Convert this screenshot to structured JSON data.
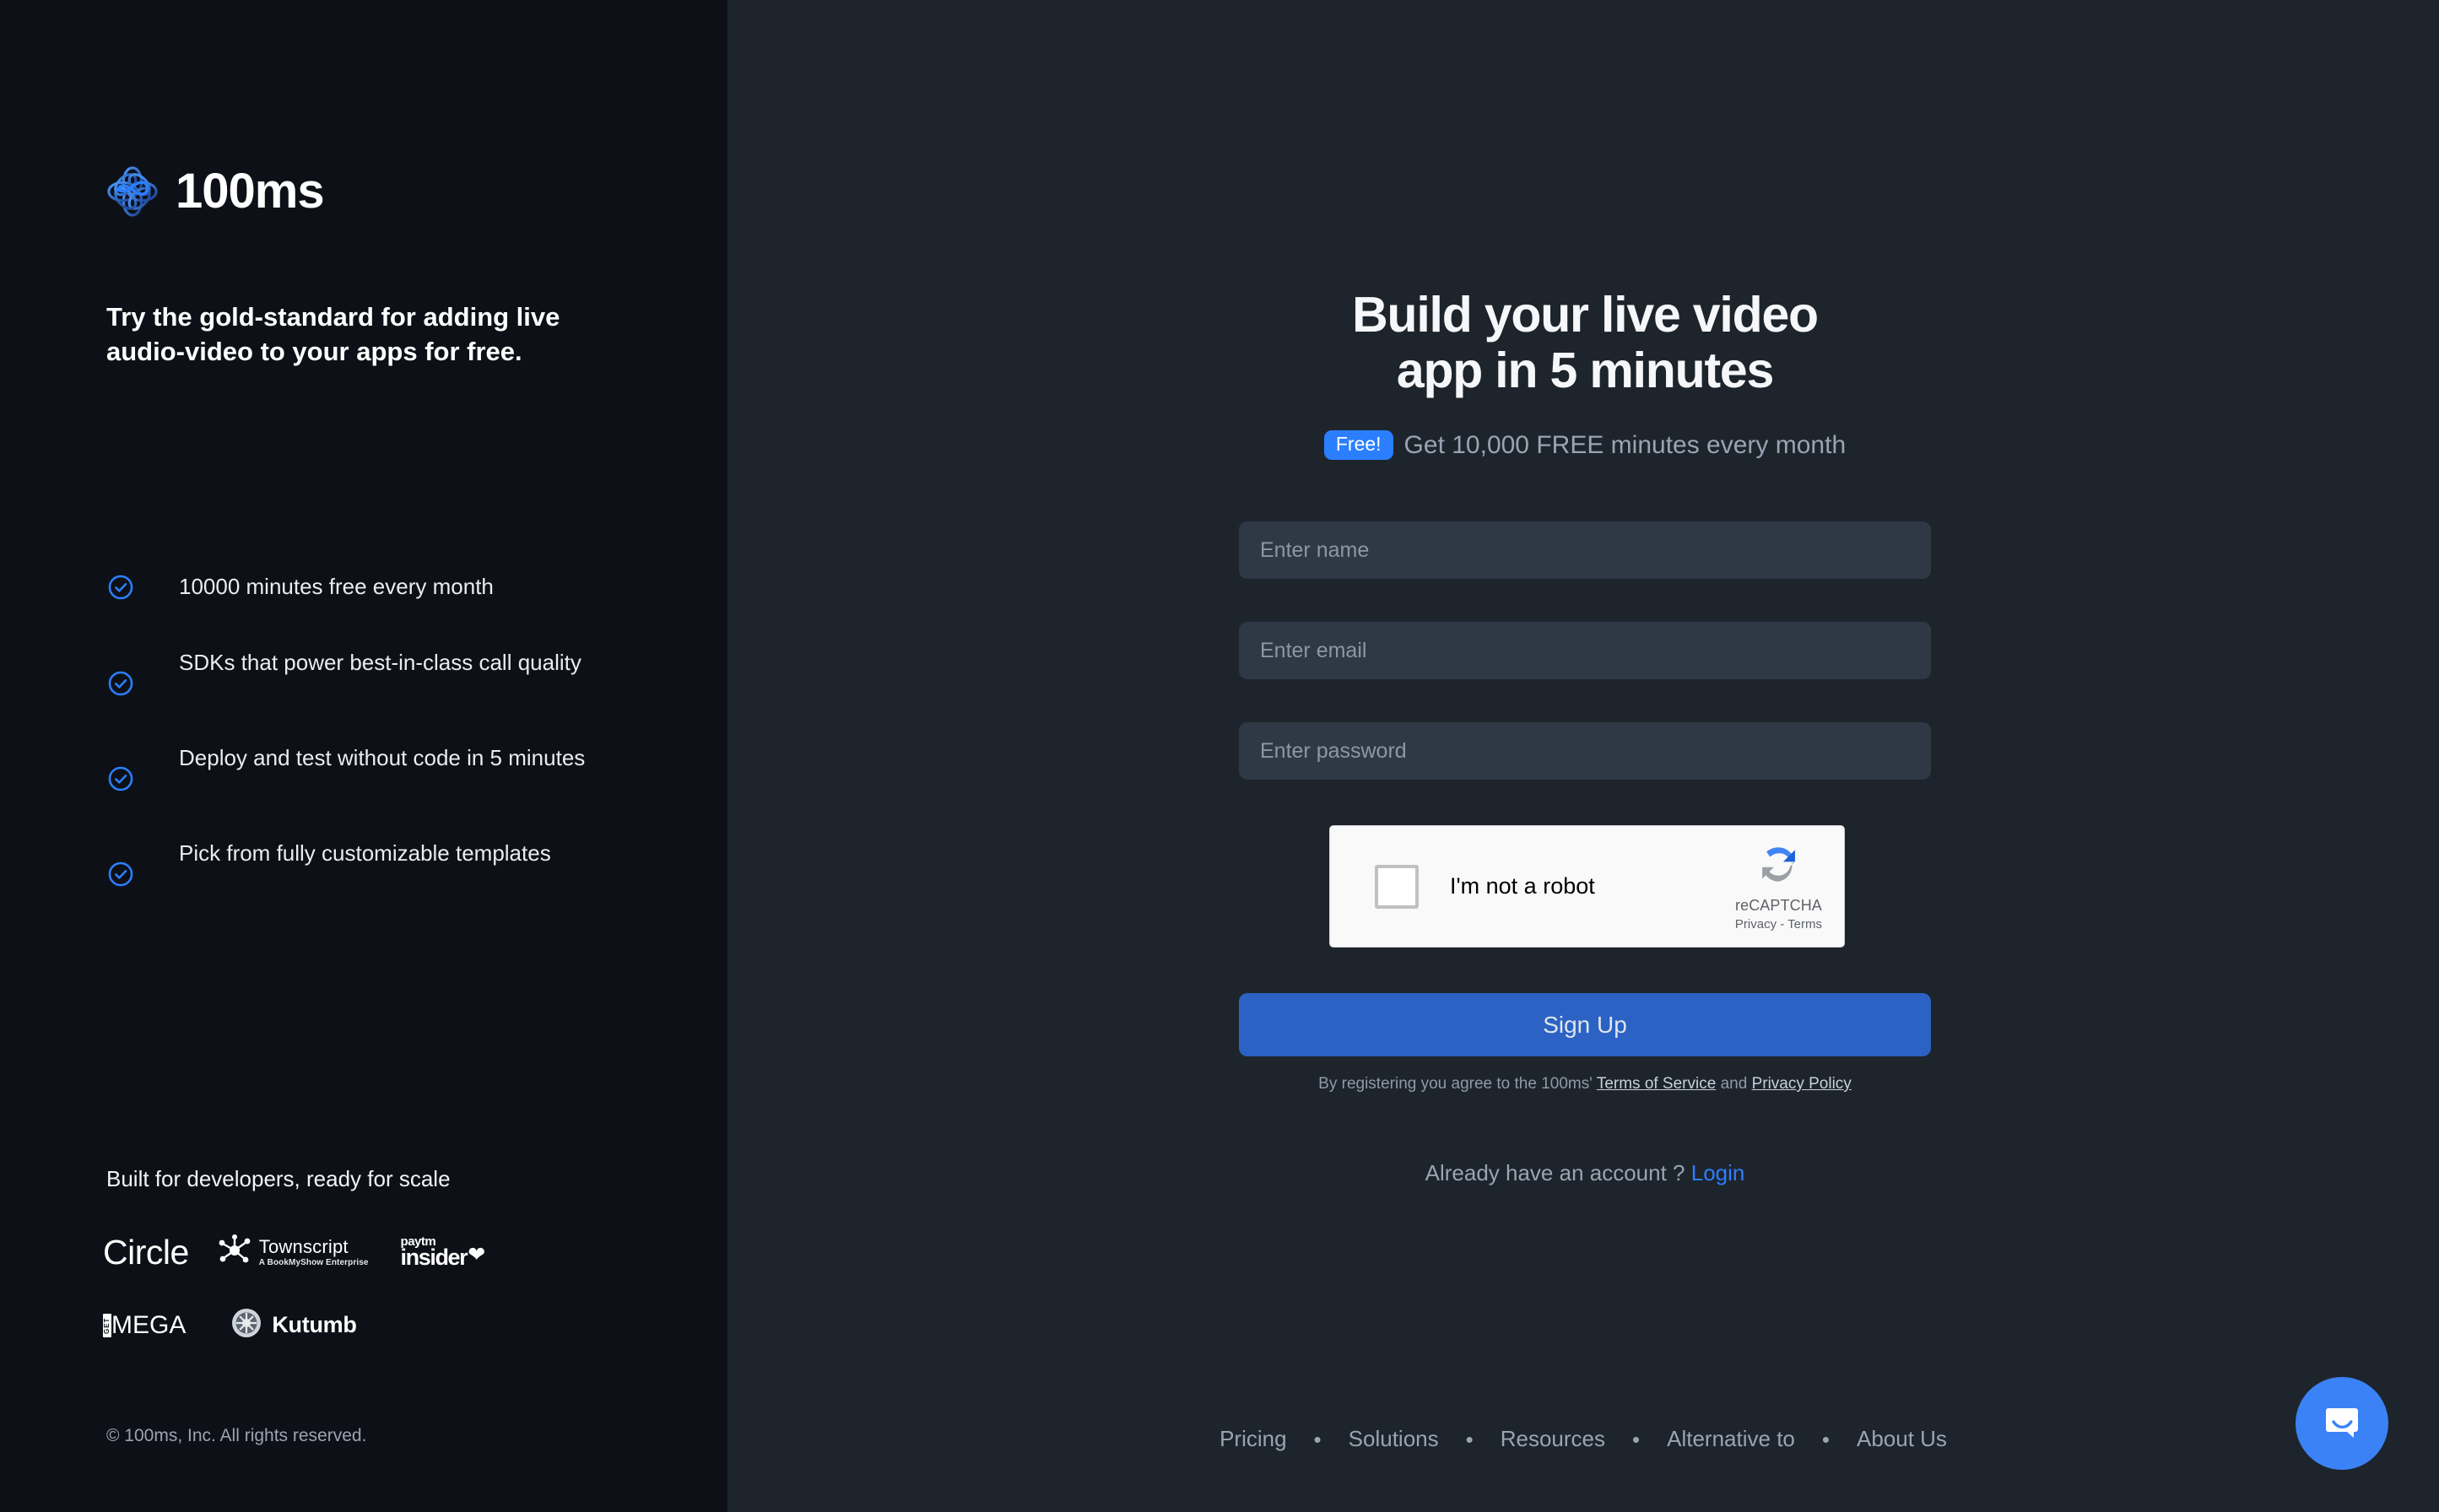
{
  "brand": {
    "name": "100ms",
    "logo_icon": "flower-knot-logo",
    "logo_color": "#2b7fff"
  },
  "left": {
    "tagline": "Try the gold-standard for adding live audio-video to your apps for free.",
    "features": [
      {
        "icon": "check-circle-icon",
        "text": "10000 minutes free every month"
      },
      {
        "icon": "check-circle-icon",
        "text": "SDKs that power best-in-class call quality"
      },
      {
        "icon": "check-circle-icon",
        "text": "Deploy and test without code in 5 minutes"
      },
      {
        "icon": "check-circle-icon",
        "text": "Pick from fully customizable templates"
      }
    ],
    "scale_heading": "Built for developers, ready for scale",
    "customer_logos": [
      {
        "name": "Circle"
      },
      {
        "name": "Townscript",
        "subtitle": "A BookMyShow Enterprise"
      },
      {
        "name_top": "paytm",
        "name_bottom": "insider"
      },
      {
        "prefix": "GET",
        "name": "MEGA"
      },
      {
        "name": "Kutumb"
      }
    ],
    "copyright": "© 100ms, Inc. All rights reserved."
  },
  "signup": {
    "headline": "Build your live video\napp in 5 minutes",
    "badge": "Free!",
    "subtext": "Get 10,000 FREE minutes every month",
    "fields": {
      "name_placeholder": "Enter name",
      "name_value": "",
      "email_placeholder": "Enter email",
      "email_value": "",
      "password_placeholder": "Enter password",
      "password_value": ""
    },
    "recaptcha": {
      "label": "I'm not a robot",
      "brand": "reCAPTCHA",
      "terms": "Privacy - Terms",
      "icon": "recaptcha-arrows-icon",
      "checked": false
    },
    "submit_label": "Sign Up",
    "terms_prefix": "By registering you agree to the 100ms' ",
    "terms_of_service": "Terms of Service",
    "terms_and": " and ",
    "privacy_policy": "Privacy Policy",
    "login_prompt": "Already have an account ? ",
    "login_link": "Login"
  },
  "footer": {
    "links": [
      "Pricing",
      "Solutions",
      "Resources",
      "Alternative to",
      "About Us"
    ],
    "separator": "•"
  },
  "chat": {
    "icon": "chat-bubble-smile-icon",
    "color": "#3b82f6"
  },
  "colors": {
    "left_bg": "#0d1117",
    "right_bg": "#1e242c",
    "accent_blue": "#2b7fff",
    "button_blue": "#2b62c4",
    "input_bg": "#2f3845",
    "muted_text": "#9aa4b2"
  }
}
